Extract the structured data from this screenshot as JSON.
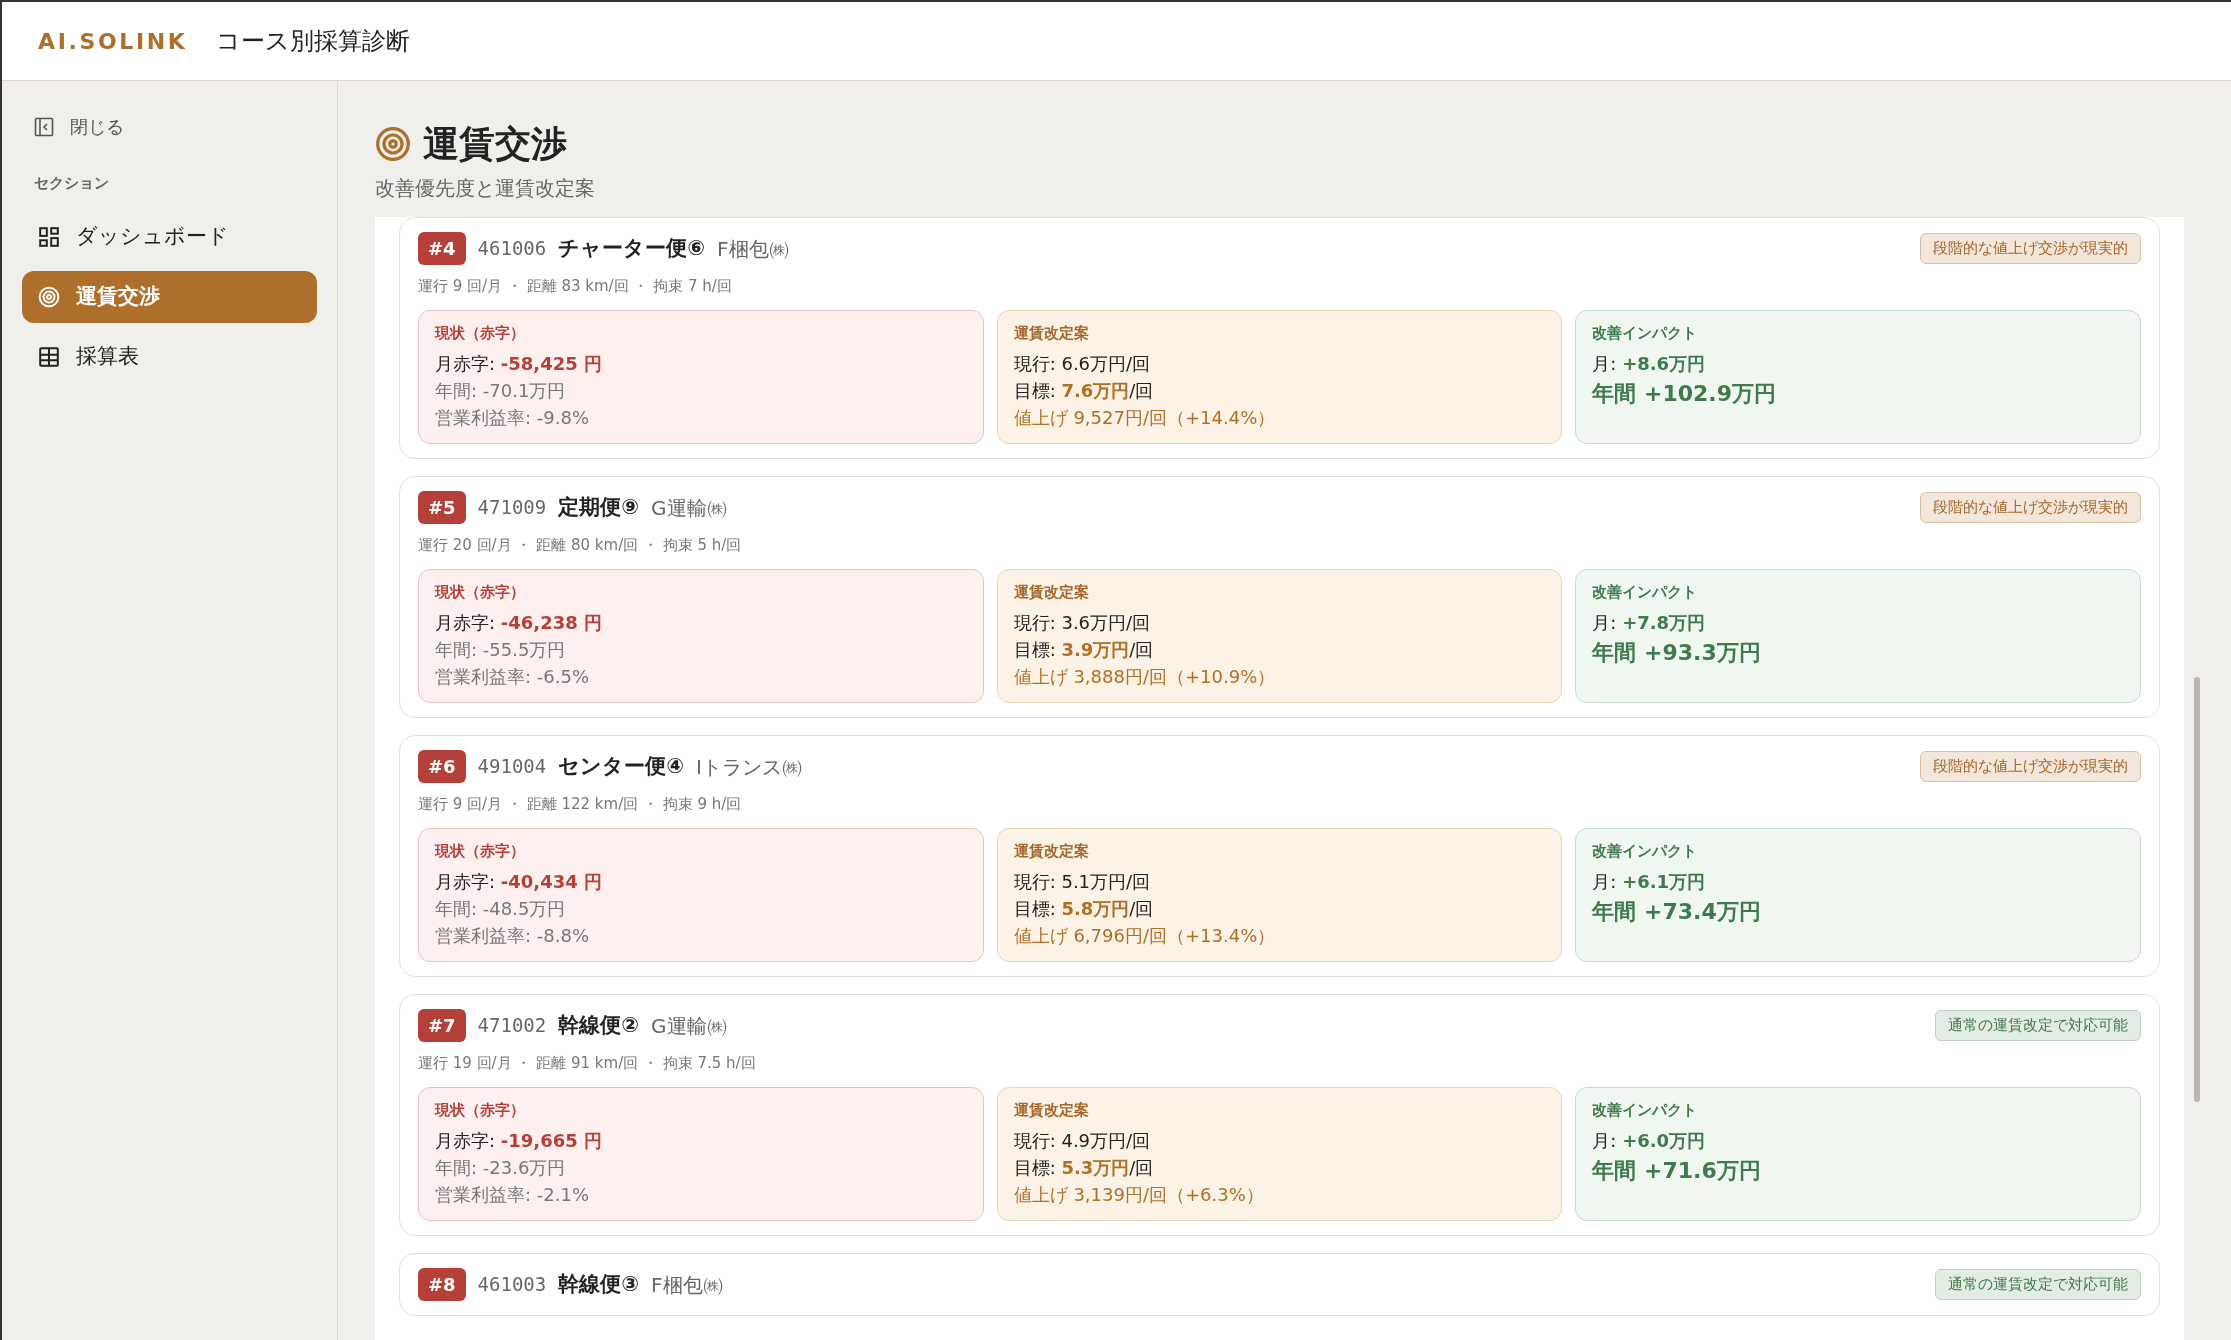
{
  "header": {
    "logo": "AI.SOLINK",
    "title": "コース別採算診断"
  },
  "sidebar": {
    "close_label": "閉じる",
    "section_label": "セクション",
    "items": [
      {
        "label": "ダッシュボード",
        "kind": "dashboard",
        "selected": false
      },
      {
        "label": "運賃交渉",
        "kind": "target",
        "selected": true
      },
      {
        "label": "採算表",
        "kind": "table",
        "selected": false
      }
    ]
  },
  "page": {
    "title": "運賃交渉",
    "subtitle": "改善優先度と運賃改定案"
  },
  "cards": [
    {
      "rank": "#4",
      "code": "461006",
      "name": "チャーター便⑥",
      "company": "F梱包㈱",
      "tag": {
        "text": "段階的な値上げ交渉が現実的",
        "kind": "stepwise"
      },
      "meta": "運行 9 回/月 ・ 距離 83 km/回 ・ 拘束 7 h/回",
      "current": {
        "label": "現状（赤字）",
        "monthly": "月赤字: **-58,425 円**",
        "annual": "年間: -70.1万円",
        "margin": "営業利益率: -9.8%"
      },
      "proposal": {
        "label": "運賃改定案",
        "current": "現行: 6.6万円/回",
        "target": "目標: **7.6万円**/回",
        "raise": "値上げ 9,527円/回（+14.4%）"
      },
      "impact": {
        "label": "改善インパクト",
        "monthly": "月: **+8.6万円**",
        "annual": "年間 +102.9万円"
      }
    },
    {
      "rank": "#5",
      "code": "471009",
      "name": "定期便⑨",
      "company": "G運輸㈱",
      "tag": {
        "text": "段階的な値上げ交渉が現実的",
        "kind": "stepwise"
      },
      "meta": "運行 20 回/月 ・ 距離 80 km/回 ・ 拘束 5 h/回",
      "current": {
        "label": "現状（赤字）",
        "monthly": "月赤字: **-46,238 円**",
        "annual": "年間: -55.5万円",
        "margin": "営業利益率: -6.5%"
      },
      "proposal": {
        "label": "運賃改定案",
        "current": "現行: 3.6万円/回",
        "target": "目標: **3.9万円**/回",
        "raise": "値上げ 3,888円/回（+10.9%）"
      },
      "impact": {
        "label": "改善インパクト",
        "monthly": "月: **+7.8万円**",
        "annual": "年間 +93.3万円"
      }
    },
    {
      "rank": "#6",
      "code": "491004",
      "name": "センター便④",
      "company": "Iトランス㈱",
      "tag": {
        "text": "段階的な値上げ交渉が現実的",
        "kind": "stepwise"
      },
      "meta": "運行 9 回/月 ・ 距離 122 km/回 ・ 拘束 9 h/回",
      "current": {
        "label": "現状（赤字）",
        "monthly": "月赤字: **-40,434 円**",
        "annual": "年間: -48.5万円",
        "margin": "営業利益率: -8.8%"
      },
      "proposal": {
        "label": "運賃改定案",
        "current": "現行: 5.1万円/回",
        "target": "目標: **5.8万円**/回",
        "raise": "値上げ 6,796円/回（+13.4%）"
      },
      "impact": {
        "label": "改善インパクト",
        "monthly": "月: **+6.1万円**",
        "annual": "年間 +73.4万円"
      }
    },
    {
      "rank": "#7",
      "code": "471002",
      "name": "幹線便②",
      "company": "G運輸㈱",
      "tag": {
        "text": "通常の運賃改定で対応可能",
        "kind": "standard"
      },
      "meta": "運行 19 回/月 ・ 距離 91 km/回 ・ 拘束 7.5 h/回",
      "current": {
        "label": "現状（赤字）",
        "monthly": "月赤字: **-19,665 円**",
        "annual": "年間: -23.6万円",
        "margin": "営業利益率: -2.1%"
      },
      "proposal": {
        "label": "運賃改定案",
        "current": "現行: 4.9万円/回",
        "target": "目標: **5.3万円**/回",
        "raise": "値上げ 3,139円/回（+6.3%）"
      },
      "impact": {
        "label": "改善インパクト",
        "monthly": "月: **+6.0万円**",
        "annual": "年間 +71.6万円"
      }
    },
    {
      "rank": "#8",
      "code": "461003",
      "name": "幹線便③",
      "company": "F梱包㈱",
      "tag": {
        "text": "通常の運賃改定で対応可能",
        "kind": "standard"
      }
    }
  ]
}
